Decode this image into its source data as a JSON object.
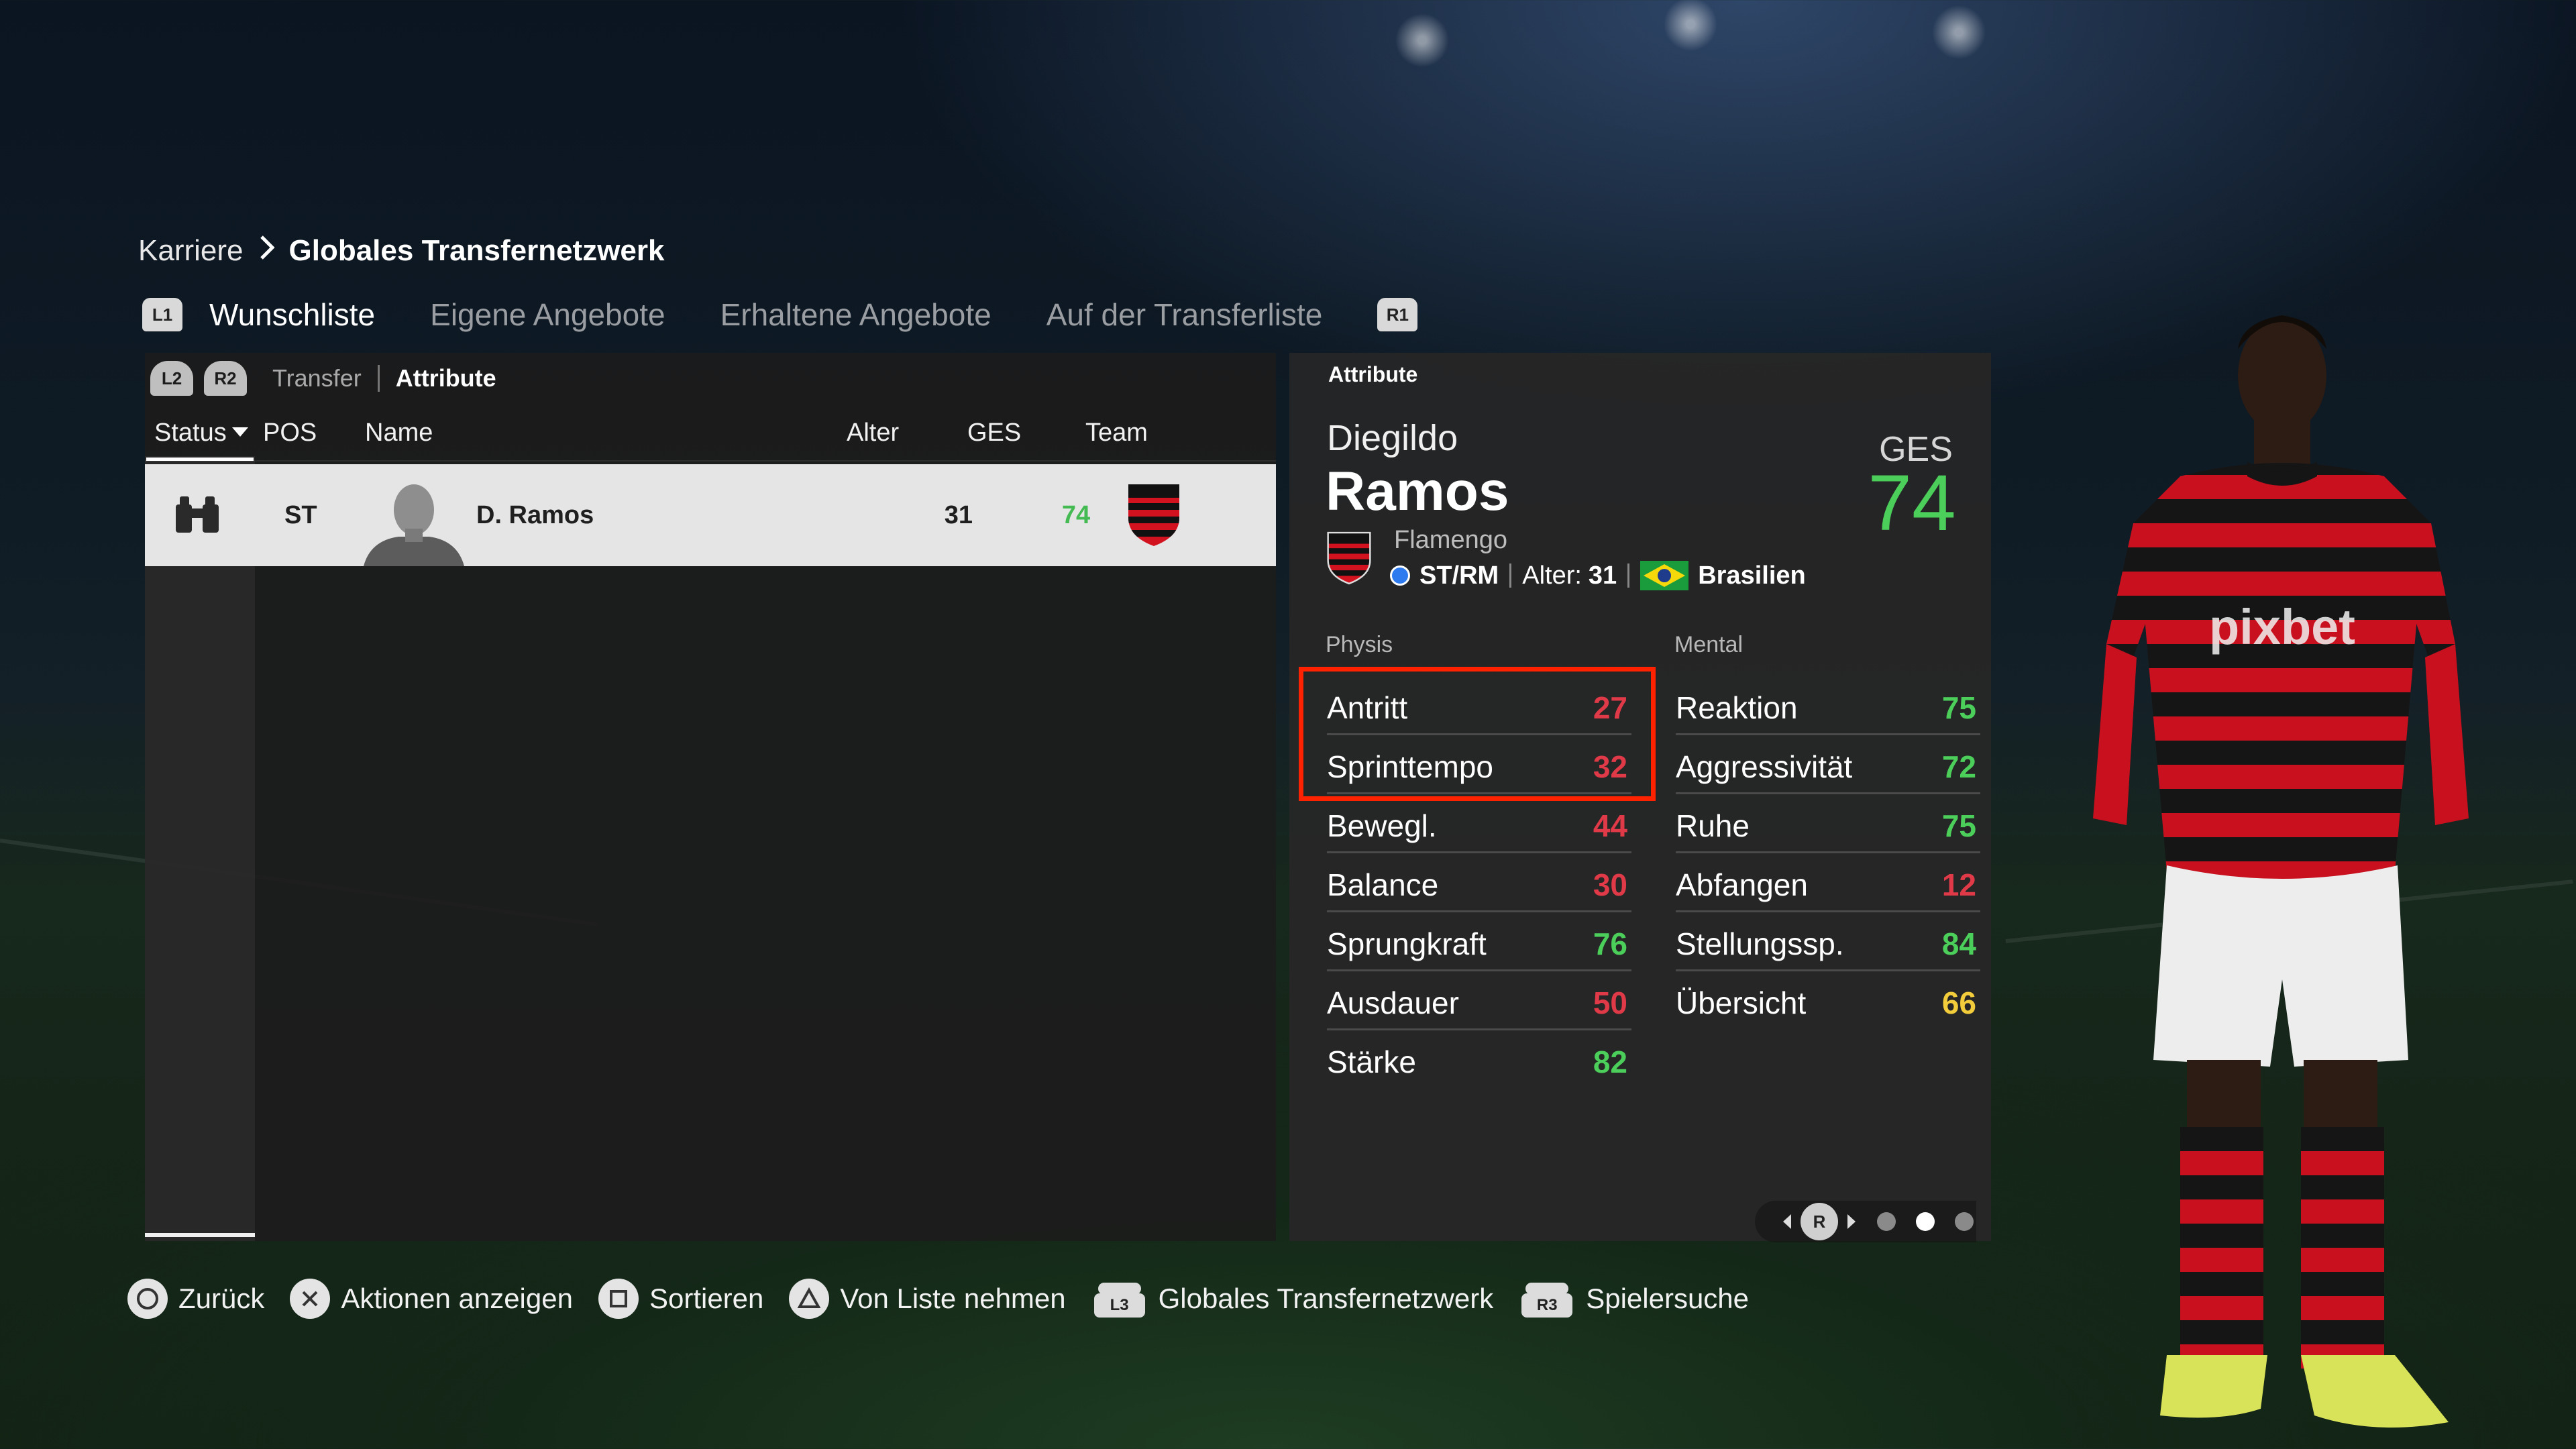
{
  "breadcrumb": {
    "parent": "Karriere",
    "separator": ">",
    "current": "Globales Transfernetzwerk"
  },
  "tabs": {
    "left_button": "L1",
    "right_button": "R1",
    "items": [
      {
        "label": "Wunschliste",
        "active": true
      },
      {
        "label": "Eigene Angebote",
        "active": false
      },
      {
        "label": "Erhaltene Angebote",
        "active": false
      },
      {
        "label": "Auf der Transferliste",
        "active": false
      }
    ]
  },
  "subview": {
    "left_button": "L2",
    "right_button": "R2",
    "options": [
      "Transfer",
      "Attribute"
    ],
    "active": "Attribute"
  },
  "table": {
    "columns": {
      "status": "Status",
      "pos": "POS",
      "name": "Name",
      "age": "Alter",
      "ges": "GES",
      "team": "Team"
    },
    "rows": [
      {
        "status_icon": "binoculars-icon",
        "pos": "ST",
        "name": "D. Ramos",
        "age": "31",
        "ges": "74",
        "team_icon": "flamengo-crest-icon"
      }
    ]
  },
  "player": {
    "panel_title": "Attribute",
    "first_name": "Diegildo",
    "last_name": "Ramos",
    "ges_label": "GES",
    "ges_value": "74",
    "club": "Flamengo",
    "positions": "ST/RM",
    "age_label": "Alter:",
    "age": "31",
    "nationality": "Brasilien"
  },
  "attributes": {
    "physis": {
      "label": "Physis",
      "items": [
        {
          "name": "Antritt",
          "value": "27",
          "rating": "low"
        },
        {
          "name": "Sprinttempo",
          "value": "32",
          "rating": "low"
        },
        {
          "name": "Bewegl.",
          "value": "44",
          "rating": "low"
        },
        {
          "name": "Balance",
          "value": "30",
          "rating": "low"
        },
        {
          "name": "Sprungkraft",
          "value": "76",
          "rating": "high"
        },
        {
          "name": "Ausdauer",
          "value": "50",
          "rating": "low"
        },
        {
          "name": "Stärke",
          "value": "82",
          "rating": "high"
        }
      ]
    },
    "mental": {
      "label": "Mental",
      "items": [
        {
          "name": "Reaktion",
          "value": "75",
          "rating": "high"
        },
        {
          "name": "Aggressivität",
          "value": "72",
          "rating": "high"
        },
        {
          "name": "Ruhe",
          "value": "75",
          "rating": "high"
        },
        {
          "name": "Abfangen",
          "value": "12",
          "rating": "low"
        },
        {
          "name": "Stellungssp.",
          "value": "84",
          "rating": "high"
        },
        {
          "name": "Übersicht",
          "value": "66",
          "rating": "mid"
        }
      ]
    }
  },
  "pager": {
    "button": "R",
    "pages": 3,
    "active_page": 2
  },
  "controls": {
    "back": "Zurück",
    "actions": "Aktionen anzeigen",
    "sort": "Sortieren",
    "remove": "Von Liste nehmen",
    "global_network": "Globales Transfernetzwerk",
    "global_network_button": "L3",
    "player_search": "Spielersuche",
    "player_search_button": "R3"
  },
  "colors": {
    "low": "#e03a48",
    "high": "#4ccf5a",
    "mid": "#f2cc3b",
    "highlight": "#ff2200"
  }
}
